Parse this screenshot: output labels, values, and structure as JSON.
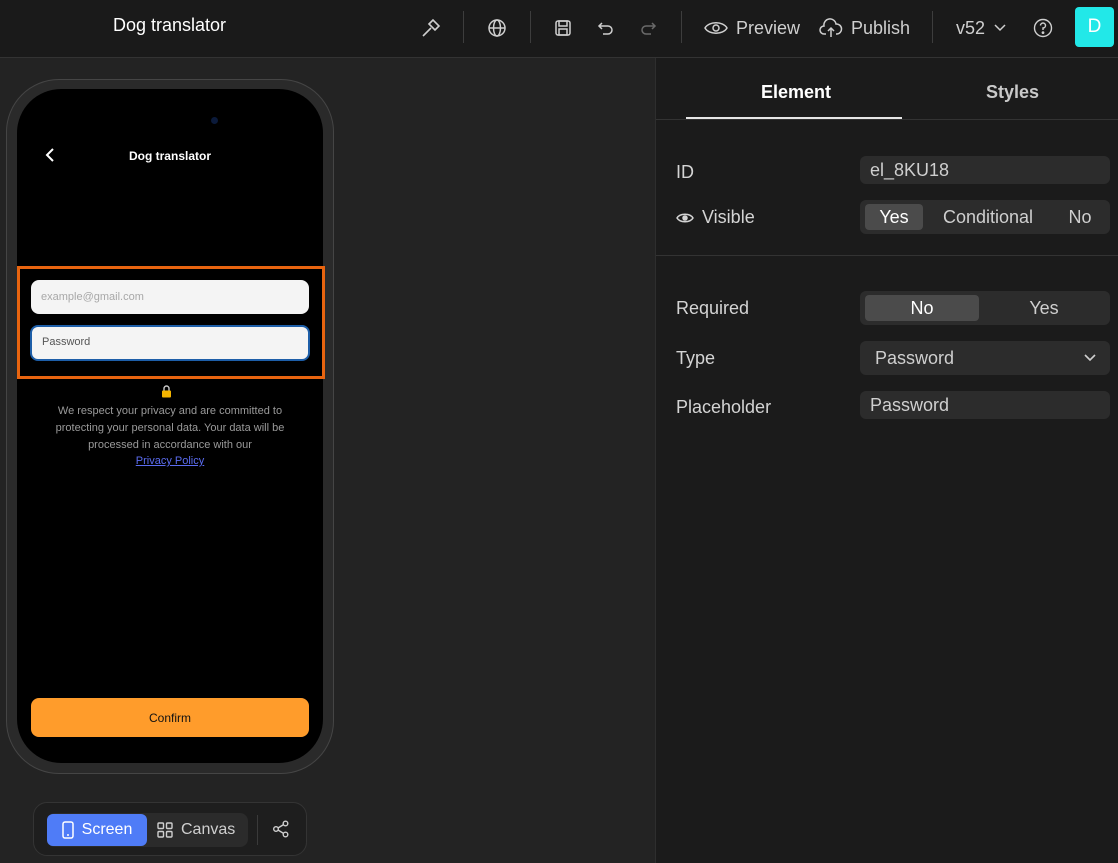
{
  "topbar": {
    "title": "Dog translator",
    "preview_label": "Preview",
    "publish_label": "Publish",
    "version": "v52",
    "avatar_initial": "D"
  },
  "phone": {
    "screen_title": "Dog translator",
    "email_placeholder": "example@gmail.com",
    "password_placeholder": "Password",
    "privacy_text": "We respect your privacy and are committed to protecting your personal data. Your data will be processed in accordance with our",
    "privacy_link": "Privacy Policy",
    "confirm_label": "Confirm"
  },
  "bottom_bar": {
    "screen_label": "Screen",
    "canvas_label": "Canvas"
  },
  "panel": {
    "tabs": [
      "Element",
      "Styles"
    ],
    "id_label": "ID",
    "id_value": "el_8KU18",
    "visible_label": "Visible",
    "visible_options": [
      "Yes",
      "Conditional",
      "No"
    ],
    "required_label": "Required",
    "required_options": [
      "No",
      "Yes"
    ],
    "type_label": "Type",
    "type_value": "Password",
    "placeholder_label": "Placeholder",
    "placeholder_value": "Password"
  },
  "colors": {
    "accent_blue": "#4f7cf7",
    "confirm_orange": "#ff9c2b",
    "highlight_orange": "#e8640f",
    "avatar_cyan": "#22e8e8"
  }
}
